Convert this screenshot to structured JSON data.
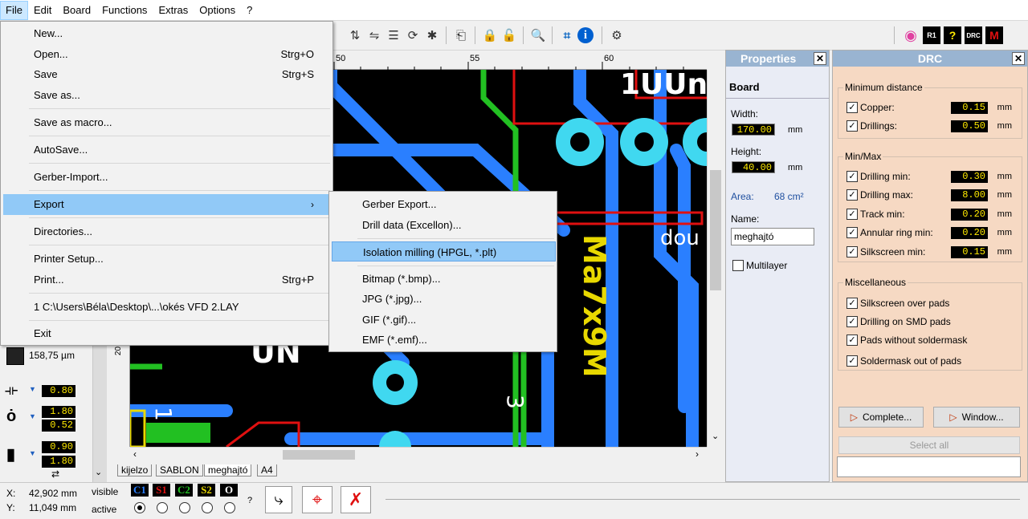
{
  "menubar": {
    "file": "File",
    "edit": "Edit",
    "board": "Board",
    "functions": "Functions",
    "extras": "Extras",
    "options": "Options",
    "help": "?"
  },
  "file_menu": {
    "new": "New...",
    "open": "Open...",
    "open_sc": "Strg+O",
    "save": "Save",
    "save_sc": "Strg+S",
    "save_as": "Save as...",
    "save_macro": "Save as macro...",
    "autosave": "AutoSave...",
    "gerber_import": "Gerber-Import...",
    "export": "Export",
    "directories": "Directories...",
    "printer_setup": "Printer Setup...",
    "print": "Print...",
    "print_sc": "Strg+P",
    "recent": "1 C:\\Users\\Béla\\Desktop\\...\\okés VFD 2.LAY",
    "exit": "Exit"
  },
  "export_menu": {
    "gerber": "Gerber Export...",
    "drill": "Drill data (Excellon)...",
    "isolation": "Isolation milling (HPGL, *.plt)",
    "bitmap": "Bitmap (*.bmp)...",
    "jpg": "JPG (*.jpg)...",
    "gif": "GIF (*.gif)...",
    "emf": "EMF (*.emf)..."
  },
  "ruler": {
    "t50": "50",
    "t55": "55",
    "t60": "60",
    "v20": "20"
  },
  "left": {
    "grid": "158,75 µm",
    "track_width": "0.80",
    "pad_outer": "1.80",
    "pad_inner": "0.52",
    "smd_w": "0.90",
    "smd_h": "1.80"
  },
  "canvas": {
    "t1": "1UUn",
    "t2": "dou",
    "t3": "Ma7x9M",
    "t4": "UN",
    "t5": "3",
    "t6": "1"
  },
  "tabs": [
    "kijelzo",
    "SABLON",
    "meghajtó",
    "A4"
  ],
  "status": {
    "x_label": "X:",
    "x_val": "42,902 mm",
    "y_label": "Y:",
    "y_val": "11,049 mm",
    "visible": "visible",
    "active": "active",
    "c1": "C1",
    "s1": "S1",
    "c2": "C2",
    "s2": "S2",
    "o": "O",
    "q": "?"
  },
  "props": {
    "title": "Properties",
    "section": "Board",
    "width_label": "Width:",
    "width_val": "170.00",
    "height_label": "Height:",
    "height_val": "40.00",
    "mm": "mm",
    "area_label": "Area:",
    "area_val": "68 cm²",
    "name_label": "Name:",
    "name_val": "meghajtó",
    "multilayer": "Multilayer"
  },
  "drc": {
    "title": "DRC",
    "g1": "Minimum distance",
    "copper": "Copper:",
    "copper_val": "0.15",
    "drillings": "Drillings:",
    "drillings_val": "0.50",
    "g2": "Min/Max",
    "drill_min": "Drilling min:",
    "drill_min_val": "0.30",
    "drill_max": "Drilling max:",
    "drill_max_val": "8.00",
    "track_min": "Track min:",
    "track_min_val": "0.20",
    "annular": "Annular ring min:",
    "annular_val": "0.20",
    "silk_min": "Silkscreen min:",
    "silk_min_val": "0.15",
    "mm": "mm",
    "g3": "Miscellaneous",
    "m1": "Silkscreen over pads",
    "m2": "Drilling on SMD pads",
    "m3": "Pads without soldermask",
    "m4": "Soldermask out of pads",
    "complete": "Complete...",
    "window": "Window...",
    "select_all": "Select all"
  },
  "colors": {
    "copper_top": "#2a7fff",
    "silk": "#e8d800",
    "pad": "#40d8f0",
    "green": "#22c022",
    "red": "#e01010"
  }
}
